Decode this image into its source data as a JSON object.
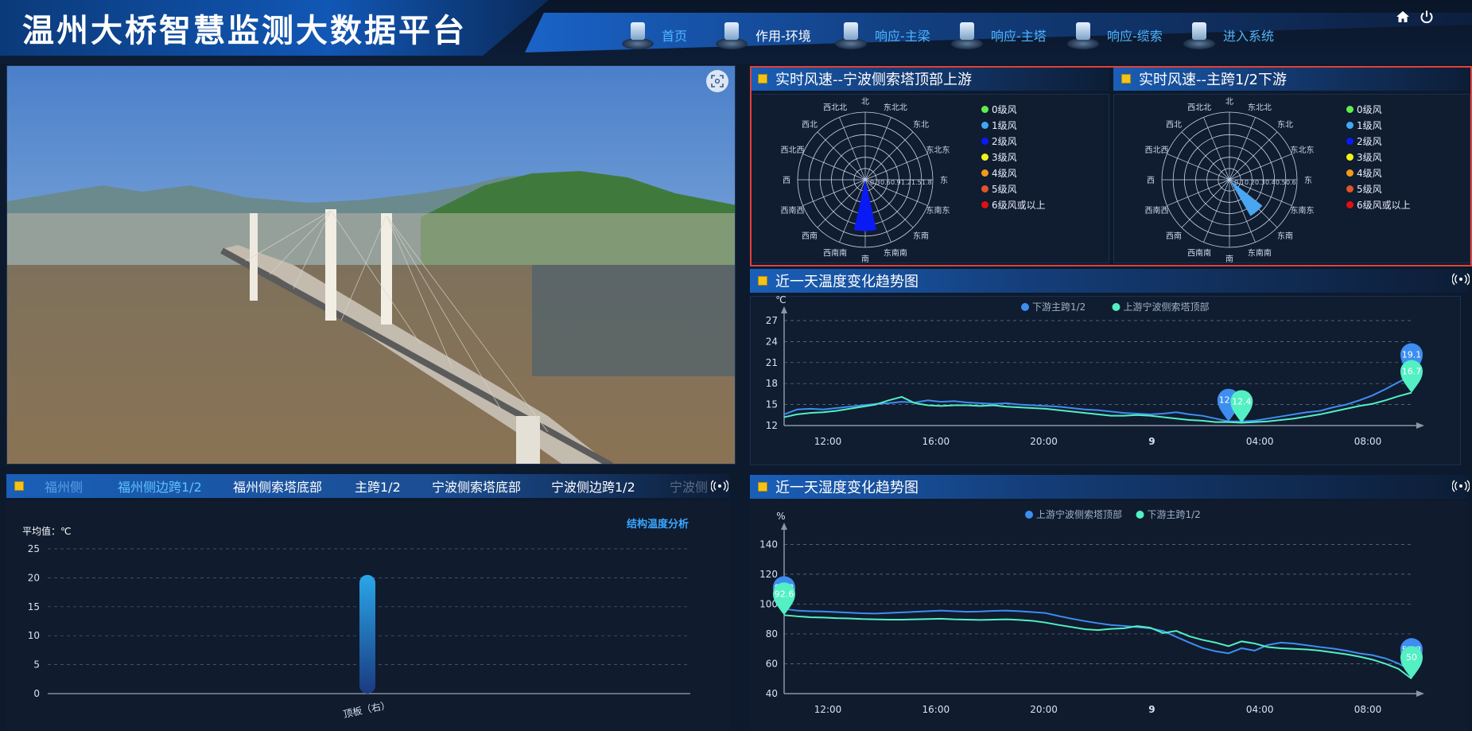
{
  "header": {
    "title": "温州大桥智慧监测大数据平台",
    "nav": [
      {
        "label": "首页",
        "active": false
      },
      {
        "label": "作用-环境",
        "active": true
      },
      {
        "label": "响应-主梁",
        "active": false
      },
      {
        "label": "响应-主塔",
        "active": false
      },
      {
        "label": "响应-缆索",
        "active": false
      },
      {
        "label": "进入系统",
        "active": false
      }
    ],
    "icons": [
      "home-icon",
      "power-icon"
    ]
  },
  "wind_left": {
    "title": "实时风速--宁波侧索塔顶部上游",
    "compass": [
      "北",
      "东北北",
      "东北",
      "东北东",
      "东",
      "东南东",
      "东南",
      "东南南",
      "南",
      "西南南",
      "西南",
      "西南西",
      "西",
      "西北西",
      "西北",
      "西北北"
    ],
    "radial_ticks": [
      "0.3",
      "0.6",
      "0.9",
      "1.2",
      "1.5",
      "1.8"
    ]
  },
  "wind_right": {
    "title": "实时风速--主跨1/2下游",
    "compass": [
      "北",
      "东北北",
      "东北",
      "东北东",
      "东",
      "东南东",
      "东南",
      "东南南",
      "南",
      "西南南",
      "西南",
      "西南西",
      "西",
      "西北西",
      "西北",
      "西北北"
    ],
    "radial_ticks": [
      "0.1",
      "0.2",
      "0.3",
      "0.4",
      "0.5",
      "0.6"
    ]
  },
  "wind_legend": [
    {
      "label": "0级风",
      "color": "#5ef04a"
    },
    {
      "label": "1级风",
      "color": "#3fa9f5"
    },
    {
      "label": "2级风",
      "color": "#0a1af5"
    },
    {
      "label": "3级风",
      "color": "#f2f21a"
    },
    {
      "label": "4级风",
      "color": "#f29a1a"
    },
    {
      "label": "5级风",
      "color": "#e2542a"
    },
    {
      "label": "6级风或以上",
      "color": "#e01010"
    }
  ],
  "temp_panel": {
    "title": "近一天温度变化趋势图"
  },
  "humid_panel": {
    "title": "近一天湿度变化趋势图"
  },
  "struct_panel": {
    "tabs": [
      "福州侧",
      "福州侧边跨1/2",
      "福州侧索塔底部",
      "主跨1/2",
      "宁波侧索塔底部",
      "宁波侧边跨1/2",
      "宁波侧"
    ],
    "active_tab": 1,
    "analysis_link": "结构温度分析"
  },
  "chart_data": [
    {
      "type": "bar",
      "ylabel": "平均值：℃",
      "ylim": [
        0,
        25
      ],
      "yticks": [
        0,
        5,
        10,
        15,
        20,
        25
      ],
      "categories": [
        "顶板（右）"
      ],
      "values": [
        20.5
      ],
      "colors": {
        "bar_top": "#2aa6e8",
        "bar_bottom": "#1a3a80"
      }
    },
    {
      "type": "line",
      "ylabel": "℃",
      "ylim": [
        12,
        27
      ],
      "yticks": [
        12,
        15,
        18,
        21,
        24,
        27
      ],
      "x_ticks": [
        "12:00",
        "16:00",
        "20:00",
        "9",
        "04:00",
        "08:00"
      ],
      "series": [
        {
          "name": "下游主跨1/2",
          "color": "#3d8ef0",
          "values": [
            13.6,
            14.3,
            14.4,
            14.3,
            14.5,
            14.7,
            14.9,
            15.1,
            15.2,
            15.4,
            15.3,
            15.6,
            15.4,
            15.5,
            15.3,
            15.2,
            15.1,
            15.2,
            15.0,
            14.9,
            14.8,
            14.7,
            14.5,
            14.3,
            14.2,
            14.0,
            13.8,
            13.7,
            13.6,
            13.7,
            13.9,
            13.6,
            13.4,
            13.0,
            12.6,
            12.6,
            12.7,
            13.0,
            13.3,
            13.6,
            13.9,
            14.1,
            14.6,
            15.0,
            15.6,
            16.3,
            17.2,
            18.2,
            19.1
          ],
          "markers": [
            {
              "value": "12.6"
            },
            {
              "value": "19.1"
            }
          ]
        },
        {
          "name": "上游宁波侧索塔顶部",
          "color": "#52f0c2",
          "values": [
            13.2,
            13.6,
            13.8,
            13.9,
            14.1,
            14.4,
            14.7,
            15.0,
            15.6,
            16.1,
            15.2,
            14.9,
            14.8,
            14.9,
            14.9,
            14.8,
            14.9,
            14.7,
            14.6,
            14.5,
            14.4,
            14.2,
            14.0,
            13.8,
            13.6,
            13.4,
            13.4,
            13.5,
            13.4,
            13.2,
            13.0,
            12.8,
            12.7,
            12.5,
            12.5,
            12.4,
            12.5,
            12.6,
            12.8,
            13.0,
            13.3,
            13.6,
            14.0,
            14.4,
            14.8,
            15.1,
            15.6,
            16.2,
            16.7
          ],
          "markers": [
            {
              "value": "12.4"
            },
            {
              "value": "16.7"
            }
          ]
        }
      ]
    },
    {
      "type": "line",
      "ylabel": "%",
      "ylim": [
        40,
        145
      ],
      "yticks": [
        40,
        60,
        80,
        100,
        120,
        140
      ],
      "x_ticks": [
        "12:00",
        "16:00",
        "20:00",
        "9",
        "04:00",
        "08:00"
      ],
      "series": [
        {
          "name": "上游宁波侧索塔顶部",
          "color": "#3d8ef0",
          "values": [
            96.8,
            95.6,
            95.2,
            95.0,
            94.6,
            94.2,
            93.8,
            93.6,
            94.0,
            94.4,
            94.8,
            95.2,
            95.6,
            95.2,
            94.8,
            95.0,
            95.4,
            95.6,
            95.2,
            94.6,
            94.0,
            92.0,
            90.2,
            88.6,
            87.2,
            86.0,
            85.4,
            84.6,
            83.8,
            82.0,
            78.0,
            74.2,
            70.6,
            68.4,
            67.0,
            70.4,
            68.8,
            72.6,
            74.2,
            73.6,
            72.4,
            71.2,
            70.2,
            68.8,
            67.0,
            65.8,
            63.6,
            60.2,
            55.3
          ],
          "markers": [
            {
              "value": "96.8"
            },
            {
              "value": "55.3"
            }
          ]
        },
        {
          "name": "下游主跨1/2",
          "color": "#52f0c2",
          "values": [
            92.6,
            91.8,
            91.2,
            91.0,
            90.6,
            90.4,
            90.0,
            89.8,
            89.6,
            89.6,
            89.8,
            90.0,
            90.2,
            89.8,
            89.6,
            89.4,
            89.6,
            89.8,
            89.4,
            88.8,
            87.6,
            86.0,
            84.6,
            83.2,
            82.6,
            83.4,
            83.8,
            85.2,
            84.2,
            80.6,
            82.0,
            78.4,
            76.0,
            74.2,
            71.8,
            75.0,
            73.6,
            71.2,
            70.4,
            70.0,
            69.6,
            68.8,
            67.6,
            66.4,
            64.8,
            62.8,
            60.0,
            56.6,
            50.0
          ],
          "markers": [
            {
              "value": "92.6"
            },
            {
              "value": "50"
            }
          ]
        }
      ]
    }
  ]
}
